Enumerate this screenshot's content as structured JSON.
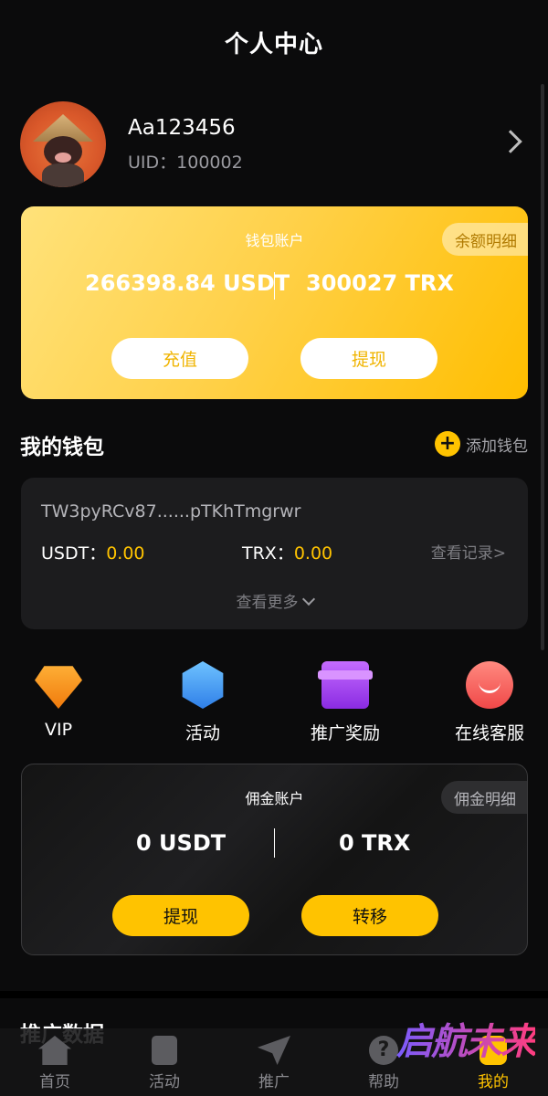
{
  "header": {
    "title": "个人中心"
  },
  "profile": {
    "name": "Aa123456",
    "uid": "UID：100002"
  },
  "wallet_account": {
    "title": "钱包账户",
    "detail_label": "余额明细",
    "usdt": "266398.84 USDT",
    "trx": "300027 TRX",
    "recharge_label": "充值",
    "withdraw_label": "提现"
  },
  "my_wallet": {
    "title": "我的钱包",
    "add_label": "添加钱包",
    "address": "TW3pyRCv87......pTKhTmgrwr",
    "usdt_label": "USDT：",
    "usdt_value": "0.00",
    "trx_label": "TRX：",
    "trx_value": "0.00",
    "records_label": "查看记录>",
    "more_label": "查看更多"
  },
  "shortcuts": [
    {
      "label": "VIP",
      "icon": "vip-diamond-icon"
    },
    {
      "label": "活动",
      "icon": "activity-badge-icon"
    },
    {
      "label": "推广奖励",
      "icon": "gift-icon"
    },
    {
      "label": "在线客服",
      "icon": "customer-service-icon"
    }
  ],
  "commission_account": {
    "title": "佣金账户",
    "detail_label": "佣金明细",
    "usdt": "0 USDT",
    "trx": "0 TRX",
    "withdraw_label": "提现",
    "transfer_label": "转移"
  },
  "stats_peek": "推广数据",
  "tabbar": [
    {
      "label": "首页",
      "icon": "home-icon"
    },
    {
      "label": "活动",
      "icon": "activity-icon"
    },
    {
      "label": "推广",
      "icon": "send-icon"
    },
    {
      "label": "帮助",
      "icon": "help-icon",
      "glyph": "?"
    },
    {
      "label": "我的",
      "icon": "profile-icon",
      "active": true
    }
  ],
  "watermark": "启航未来",
  "colors": {
    "accent": "#ffc300",
    "background": "#0b0b0c",
    "card": "#1c1c1e"
  }
}
